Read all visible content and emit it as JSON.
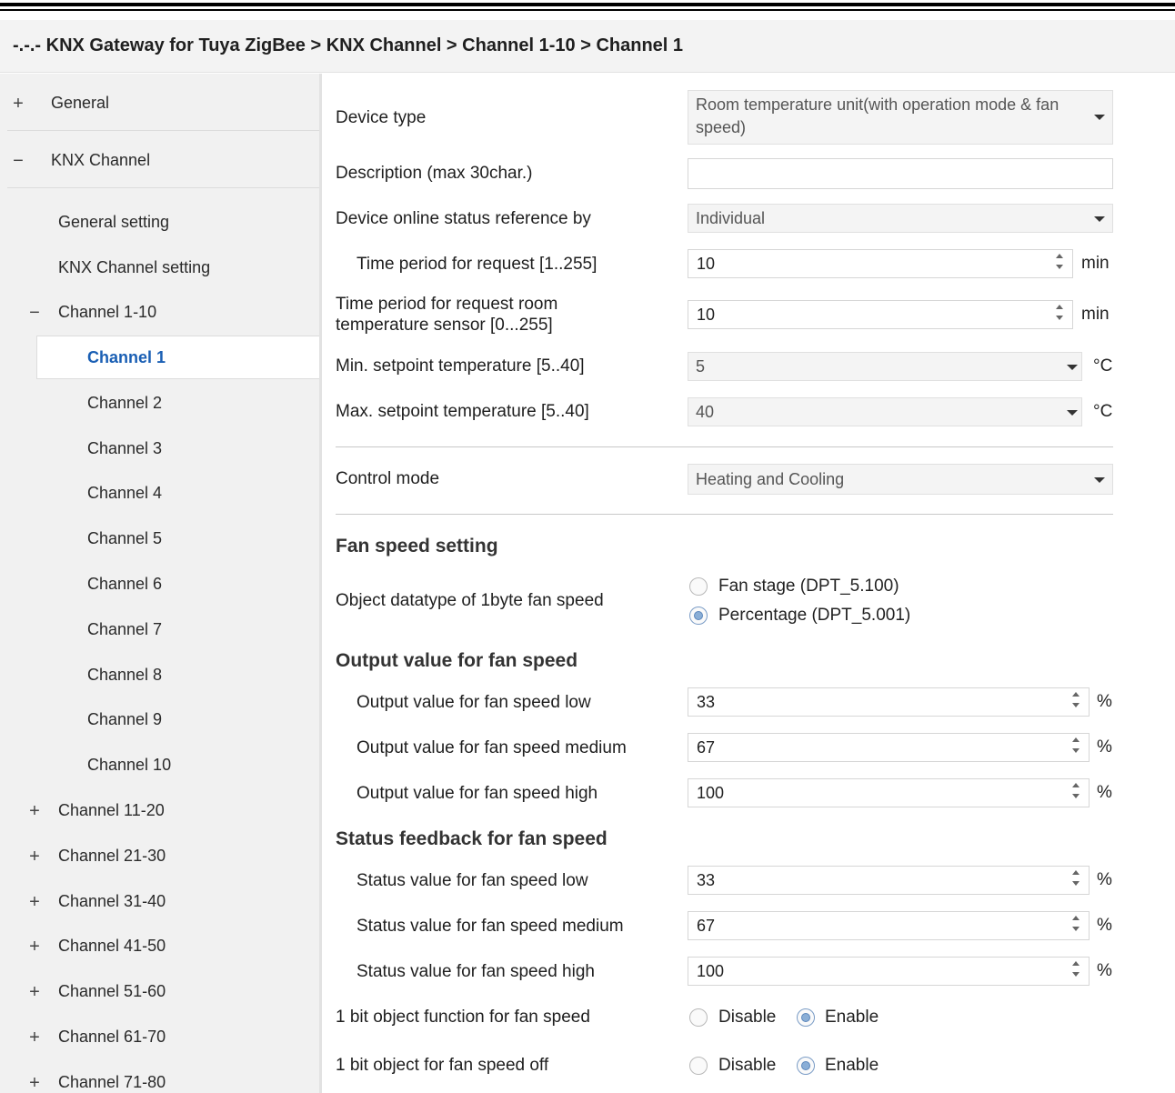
{
  "breadcrumb": "-.-.- KNX Gateway for Tuya ZigBee > KNX Channel > Channel 1-10 > Channel 1",
  "sidebar": {
    "general": {
      "sign": "+",
      "label": "General"
    },
    "knx_channel": {
      "sign": "−",
      "label": "KNX Channel"
    },
    "general_setting": "General setting",
    "knx_channel_setting": "KNX Channel setting",
    "channel_1_10": {
      "sign": "−",
      "label": "Channel 1-10"
    },
    "channels": [
      "Channel 1",
      "Channel 2",
      "Channel 3",
      "Channel 4",
      "Channel 5",
      "Channel 6",
      "Channel 7",
      "Channel 8",
      "Channel 9",
      "Channel 10"
    ],
    "groups": [
      {
        "sign": "+",
        "label": "Channel 11-20"
      },
      {
        "sign": "+",
        "label": "Channel 21-30"
      },
      {
        "sign": "+",
        "label": "Channel 31-40"
      },
      {
        "sign": "+",
        "label": "Channel 41-50"
      },
      {
        "sign": "+",
        "label": "Channel 51-60"
      },
      {
        "sign": "+",
        "label": "Channel 61-70"
      },
      {
        "sign": "+",
        "label": "Channel 71-80"
      }
    ]
  },
  "params": {
    "device_type": {
      "label": "Device type",
      "value": "Room temperature unit(with operation mode & fan speed)"
    },
    "description": {
      "label": "Description (max 30char.)",
      "value": ""
    },
    "online_status": {
      "label": "Device online status reference by",
      "value": "Individual"
    },
    "time_request": {
      "label": "Time period for request [1..255]",
      "value": "10",
      "unit": "min"
    },
    "time_request_sensor": {
      "label_line1": "Time period for request room",
      "label_line2": "temperature sensor [0...255]",
      "value": "10",
      "unit": "min"
    },
    "min_setpoint": {
      "label": "Min. setpoint temperature [5..40]",
      "value": "5",
      "unit": "°C"
    },
    "max_setpoint": {
      "label": "Max. setpoint temperature [5..40]",
      "value": "40",
      "unit": "°C"
    },
    "control_mode": {
      "label": "Control mode",
      "value": "Heating and Cooling"
    }
  },
  "fan": {
    "section_title": "Fan speed setting",
    "datatype": {
      "label": "Object datatype of 1byte fan speed",
      "option1": "Fan stage (DPT_5.100)",
      "option2": "Percentage (DPT_5.001)",
      "selected": "option2"
    },
    "output_title": "Output value for fan speed",
    "output_low": {
      "label": "Output value for fan speed low",
      "value": "33",
      "unit": "%"
    },
    "output_medium": {
      "label": "Output value for fan speed medium",
      "value": "67",
      "unit": "%"
    },
    "output_high": {
      "label": "Output value for fan speed high",
      "value": "100",
      "unit": "%"
    },
    "status_title": "Status feedback for fan speed",
    "status_low": {
      "label": "Status value for fan speed low",
      "value": "33",
      "unit": "%"
    },
    "status_medium": {
      "label": "Status value for fan speed medium",
      "value": "67",
      "unit": "%"
    },
    "status_high": {
      "label": "Status value for fan speed high",
      "value": "100",
      "unit": "%"
    },
    "bit_function": {
      "label": "1 bit object function for fan speed",
      "disable": "Disable",
      "enable": "Enable",
      "selected": "enable"
    },
    "bit_off": {
      "label": "1 bit object for fan speed off",
      "disable": "Disable",
      "enable": "Enable",
      "selected": "enable"
    }
  }
}
